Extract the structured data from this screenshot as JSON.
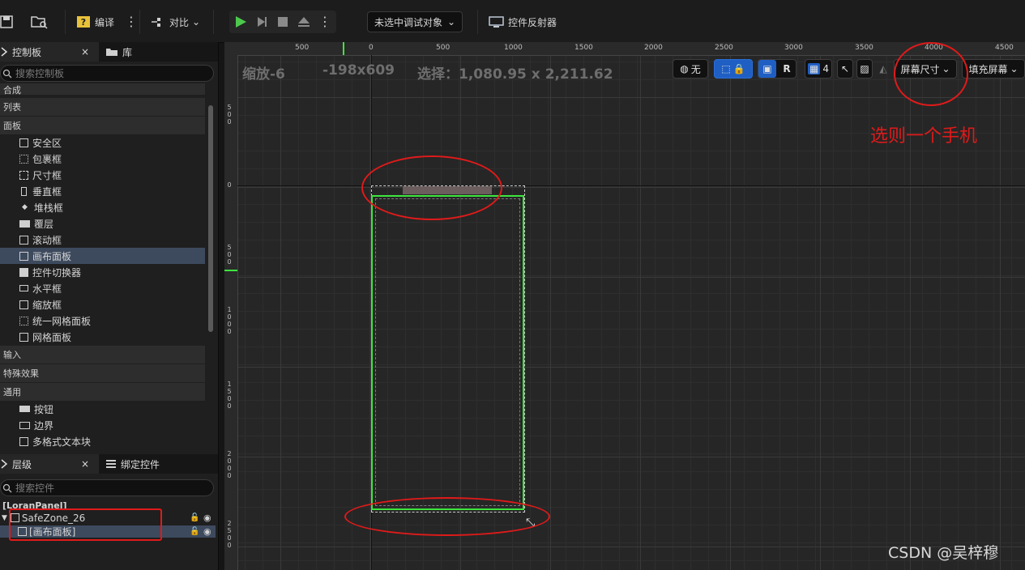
{
  "toolbar": {
    "compile_label": "编译",
    "diff_label": "对比",
    "debug_select_label": "未选中调试对象",
    "reflector_label": "控件反射器"
  },
  "palette": {
    "tab_label": "控制板",
    "library_tab_label": "库",
    "search_placeholder": "搜索控制板",
    "categories": [
      "合成",
      "列表",
      "面板",
      "输入",
      "特殊效果",
      "通用"
    ],
    "panel_items": [
      "安全区",
      "包裹框",
      "尺寸框",
      "垂直框",
      "堆栈框",
      "覆层",
      "滚动框",
      "画布面板",
      "控件切换器",
      "水平框",
      "缩放框",
      "统一网格面板",
      "网格面板"
    ],
    "common_items": [
      "按钮",
      "边界",
      "多格式文本块"
    ]
  },
  "hierarchy": {
    "tab_label": "层级",
    "bind_tab_label": "绑定控件",
    "search_placeholder": "搜索控件",
    "root": "[LoranPanel]",
    "nodes": [
      "SafeZone_26",
      "[画布面板]"
    ]
  },
  "viewport": {
    "ruler_top": [
      "500",
      "0",
      "500",
      "1000",
      "1500",
      "2000",
      "2500",
      "3000",
      "3500",
      "4000",
      "4500"
    ],
    "ruler_left": [
      "5 0 0",
      "0",
      "5 0 0",
      "1 0 0 0",
      "1 5 0 0",
      "2 0 0 0",
      "2 5 0 0"
    ],
    "zoom_label": "缩放-6",
    "coords_label": "-198x609",
    "selection_label": "选择：1,080.95 x 2,211.62",
    "none_label": "无",
    "r_label": "R",
    "grid_count": "4",
    "screen_size_label": "屏幕尺寸",
    "fill_screen_label": "填充屏幕"
  },
  "annotation": {
    "note": "选则一个手机",
    "watermark": "CSDN @吴梓穆"
  },
  "colors": {
    "accent_blue": "#1f5fc4",
    "annotation_red": "#e01a1a",
    "widget_green": "#3ee63e",
    "selected_row": "#3d4a5e"
  }
}
